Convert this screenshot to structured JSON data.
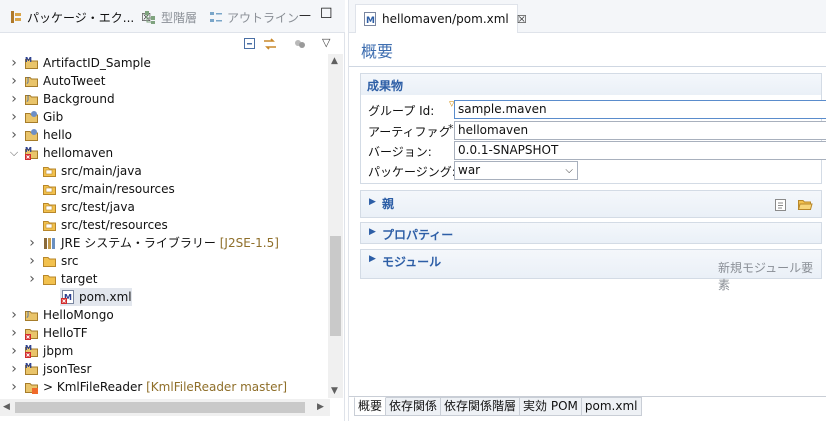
{
  "left_view": {
    "tabs": [
      {
        "label": "パッケージ・エク...",
        "close": "☒"
      },
      {
        "label": "型階層"
      },
      {
        "label": "アウトライン"
      }
    ],
    "window_buttons": {
      "minimize": "—",
      "maximize": "☐"
    }
  },
  "tree": {
    "items": [
      {
        "label": "ArtifactID_Sample",
        "level": 0,
        "expanded": false,
        "icon": "maven-project-icon"
      },
      {
        "label": "AutoTweet",
        "level": 0,
        "expanded": false,
        "icon": "java-project-icon"
      },
      {
        "label": "Background",
        "level": 0,
        "expanded": false,
        "icon": "java-project-icon"
      },
      {
        "label": "Gib",
        "level": 0,
        "expanded": false,
        "icon": "plugin-project-icon"
      },
      {
        "label": "hello",
        "level": 0,
        "expanded": false,
        "icon": "plugin-project-icon"
      },
      {
        "label": "hellomaven",
        "level": 0,
        "expanded": true,
        "icon": "maven-project-error-icon"
      },
      {
        "label": "src/main/java",
        "level": 1,
        "expanded": null,
        "icon": "source-folder-icon"
      },
      {
        "label": "src/main/resources",
        "level": 1,
        "expanded": null,
        "icon": "source-folder-icon"
      },
      {
        "label": "src/test/java",
        "level": 1,
        "expanded": null,
        "icon": "source-folder-icon"
      },
      {
        "label": "src/test/resources",
        "level": 1,
        "expanded": null,
        "icon": "source-folder-icon"
      },
      {
        "label": "JRE システム・ライブラリー",
        "decoration": "[J2SE-1.5]",
        "level": 1,
        "expanded": false,
        "icon": "library-icon"
      },
      {
        "label": "src",
        "level": 1,
        "expanded": false,
        "icon": "folder-icon"
      },
      {
        "label": "target",
        "level": 1,
        "expanded": false,
        "icon": "folder-icon"
      },
      {
        "label": "pom.xml",
        "level": 2,
        "expanded": null,
        "icon": "pom-file-icon",
        "selected": true
      },
      {
        "label": "HelloMongo",
        "level": 0,
        "expanded": false,
        "icon": "java-project-icon"
      },
      {
        "label": "HelloTF",
        "level": 0,
        "expanded": false,
        "icon": "java-project-error-icon"
      },
      {
        "label": "jbpm",
        "level": 0,
        "expanded": false,
        "icon": "maven-project-error-icon"
      },
      {
        "label": "jsonTesr",
        "level": 0,
        "expanded": false,
        "icon": "maven-project-icon"
      },
      {
        "label": "> KmlFileReader",
        "decoration": "[KmlFileReader master]",
        "level": 0,
        "expanded": false,
        "icon": "git-project-icon"
      }
    ]
  },
  "editor": {
    "tab_label": "hellomaven/pom.xml",
    "tab_close": "☒",
    "form_title": "概要",
    "artifact_section": {
      "title": "成果物",
      "group_id_label": "グループ Id:",
      "group_id_value": "sample.maven",
      "artifact_id_label": "アーティファクト Id:",
      "required_marker": "*",
      "artifact_id_value": "hellomaven",
      "version_label": "バージョン:",
      "version_value": "0.0.1-SNAPSHOT",
      "packaging_label": "パッケージング:",
      "packaging_value": "war"
    },
    "parent_section": {
      "title": "親"
    },
    "properties_section": {
      "title": "プロパティー"
    },
    "modules_section": {
      "title": "モジュール",
      "action": "新規モジュール要素"
    },
    "bottom_tabs": [
      "概要",
      "依存関係",
      "依存関係階層",
      "実効 POM",
      "pom.xml"
    ]
  },
  "colors": {
    "accent": "#2d5ea6",
    "form_title": "#3e6eb0",
    "decoration": "#8f6f2a",
    "error": "#d22b2b"
  }
}
